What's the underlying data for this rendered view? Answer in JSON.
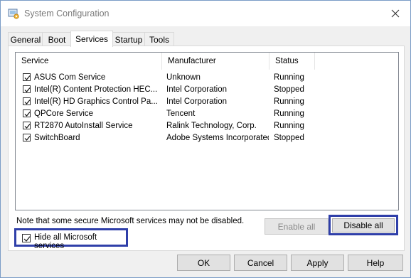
{
  "window": {
    "title": "System Configuration",
    "accent_color": "#2f3fa9"
  },
  "tabs": [
    {
      "label": "General",
      "active": false
    },
    {
      "label": "Boot",
      "active": false
    },
    {
      "label": "Services",
      "active": true
    },
    {
      "label": "Startup",
      "active": false
    },
    {
      "label": "Tools",
      "active": false
    }
  ],
  "services": {
    "columns": {
      "service": "Service",
      "manufacturer": "Manufacturer",
      "status": "Status"
    },
    "rows": [
      {
        "checked": true,
        "service": "ASUS Com Service",
        "manufacturer": "Unknown",
        "status": "Running"
      },
      {
        "checked": true,
        "service": "Intel(R) Content Protection HEC...",
        "manufacturer": "Intel Corporation",
        "status": "Stopped"
      },
      {
        "checked": true,
        "service": "Intel(R) HD Graphics Control Pa...",
        "manufacturer": "Intel Corporation",
        "status": "Running"
      },
      {
        "checked": true,
        "service": "QPCore Service",
        "manufacturer": "Tencent",
        "status": "Running"
      },
      {
        "checked": true,
        "service": "RT2870 AutoInstall Service",
        "manufacturer": "Ralink Technology, Corp.",
        "status": "Running"
      },
      {
        "checked": true,
        "service": "SwitchBoard",
        "manufacturer": "Adobe Systems Incorporated",
        "status": "Stopped"
      }
    ],
    "note": "Note that some secure Microsoft services may not be disabled.",
    "enable_all_label": "Enable all",
    "disable_all_label": "Disable all",
    "hide_ms_label": "Hide all Microsoft services",
    "hide_ms_checked": true
  },
  "footer": {
    "ok_label": "OK",
    "cancel_label": "Cancel",
    "apply_label": "Apply",
    "help_label": "Help"
  }
}
